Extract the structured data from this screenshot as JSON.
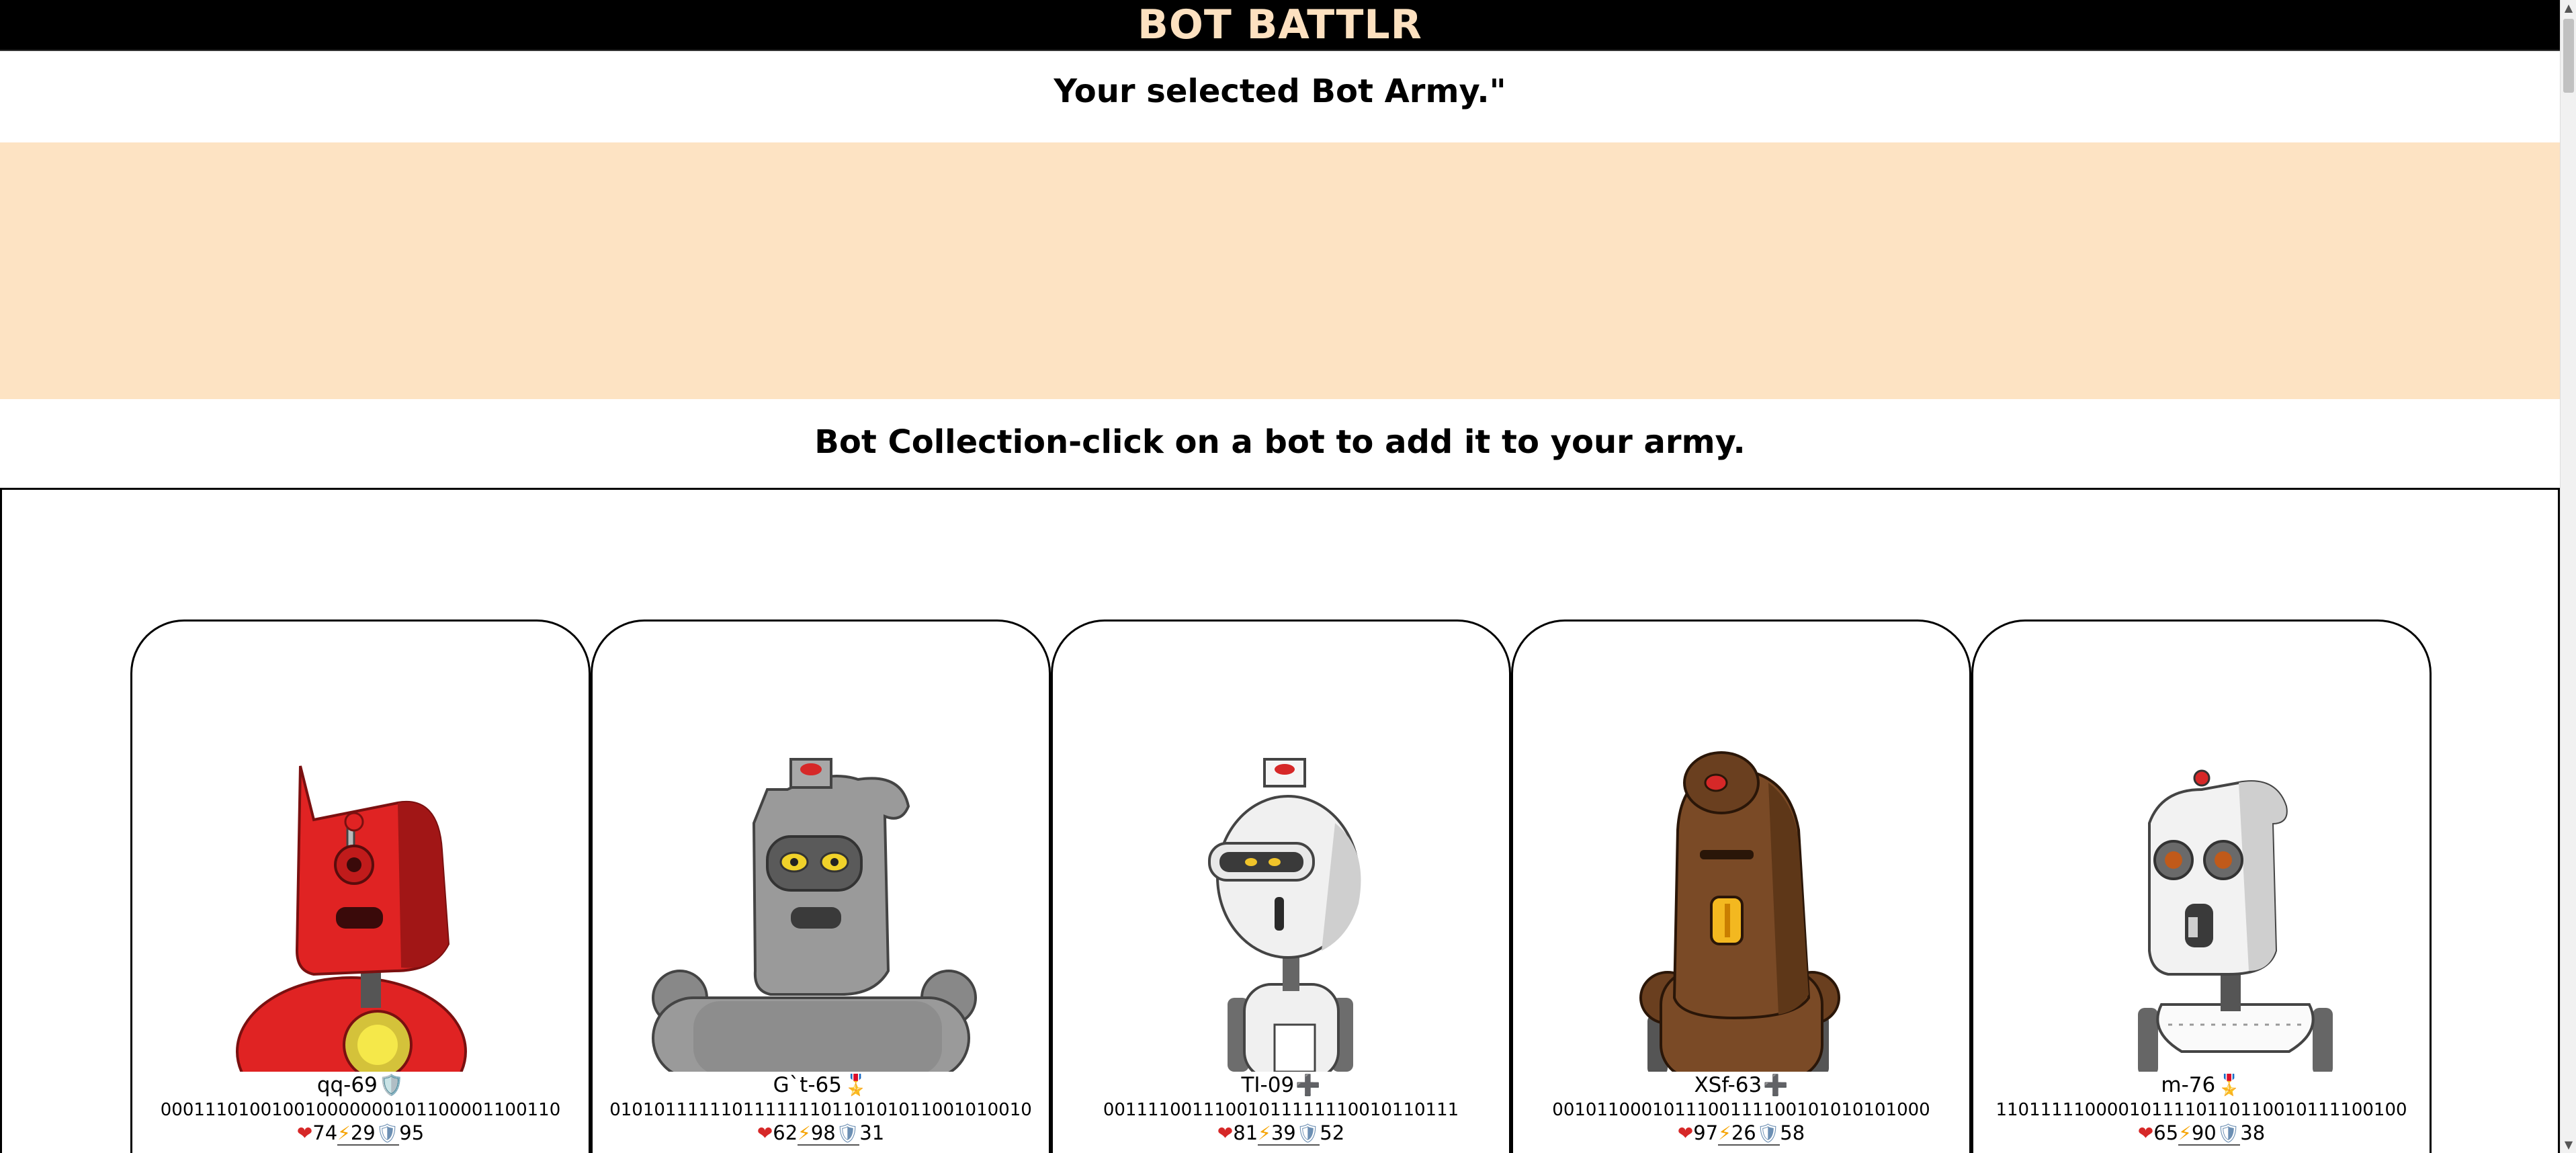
{
  "header": {
    "title": "BOT BATTLR"
  },
  "army": {
    "heading": "Your selected Bot Army.\""
  },
  "collection": {
    "heading": "Bot Collection-click on a bot to add it to your army.",
    "bots": [
      {
        "name": "qq-69",
        "class_icon": "🛡️",
        "catchphrase": "0001110100100100000001011000011001​10",
        "health": "74",
        "damage": "29",
        "armor": "95",
        "color": "#e02323"
      },
      {
        "name": "G`t-65",
        "class_icon": "🎖️",
        "catchphrase": "0101011111101111111011010101100101001​0",
        "health": "62",
        "damage": "98",
        "armor": "31",
        "color": "#9a9a9a"
      },
      {
        "name": "TI-09",
        "class_icon": "➕",
        "catchphrase": "00111100111001011111110010110111",
        "health": "81",
        "damage": "39",
        "armor": "52",
        "color": "#f0f0f0"
      },
      {
        "name": "XSf-63",
        "class_icon": "➕",
        "catchphrase": "0010110001011100111100101010101000",
        "health": "97",
        "damage": "26",
        "armor": "58",
        "color": "#7a4a26"
      },
      {
        "name": "m-76",
        "class_icon": "🎖️",
        "catchphrase": "110111110000101111011011001011110​0100",
        "health": "65",
        "damage": "90",
        "armor": "38",
        "color": "#ececec"
      }
    ]
  },
  "icons": {
    "health": "heart-icon",
    "damage": "lightning-bolt-icon",
    "armor": "shield-icon"
  },
  "colors": {
    "header_bg": "#000000",
    "header_text": "#fde1c0",
    "army_bg": "#fde3c3"
  }
}
